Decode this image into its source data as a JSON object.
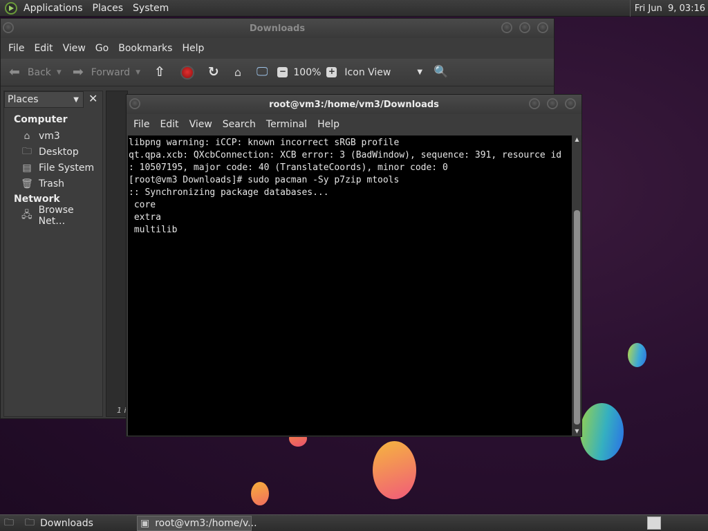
{
  "top_panel": {
    "menus": [
      "Applications",
      "Places",
      "System"
    ],
    "clock": "Fri Jun  9, 03:16"
  },
  "file_manager": {
    "title": "Downloads",
    "menu": [
      "File",
      "Edit",
      "View",
      "Go",
      "Bookmarks",
      "Help"
    ],
    "toolbar": {
      "back": "Back",
      "forward": "Forward",
      "zoom": "100%",
      "view_mode": "Icon View"
    },
    "sidebar": {
      "header": "Places",
      "groups": [
        {
          "label": "Computer",
          "items": [
            {
              "label": "vm3",
              "icon": "home-folder-icon"
            },
            {
              "label": "Desktop",
              "icon": "desktop-folder-icon"
            },
            {
              "label": "File System",
              "icon": "drive-icon"
            },
            {
              "label": "Trash",
              "icon": "trash-icon"
            }
          ]
        },
        {
          "label": "Network",
          "items": [
            {
              "label": "Browse Net…",
              "icon": "network-icon"
            }
          ]
        }
      ]
    },
    "status": "1 i"
  },
  "terminal": {
    "title": "root@vm3:/home/vm3/Downloads",
    "menu": [
      "File",
      "Edit",
      "View",
      "Search",
      "Terminal",
      "Help"
    ],
    "lines": [
      "libpng warning: iCCP: known incorrect sRGB profile",
      "qt.qpa.xcb: QXcbConnection: XCB error: 3 (BadWindow), sequence: 391, resource id",
      ": 10507195, major code: 40 (TranslateCoords), minor code: 0",
      "[root@vm3 Downloads]# sudo pacman -Sy p7zip mtools",
      ":: Synchronizing package databases...",
      " core",
      " extra",
      " multilib"
    ]
  },
  "taskbar": {
    "items": [
      {
        "label": "Downloads",
        "icon": "folder-icon",
        "active": false
      },
      {
        "label": "root@vm3:/home/v...",
        "icon": "terminal-icon",
        "active": true
      }
    ]
  }
}
